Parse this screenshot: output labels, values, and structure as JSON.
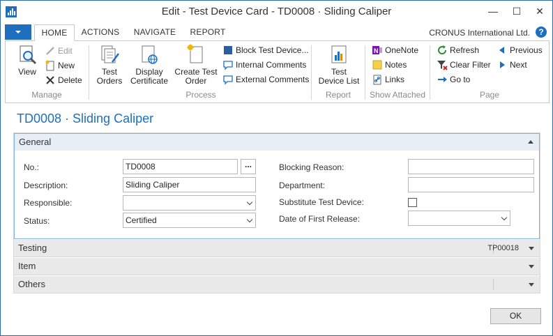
{
  "window": {
    "title": "Edit - Test Device Card - TD0008 · Sliding Caliper",
    "controls": {
      "minimize": "—",
      "maximize": "☐",
      "close": "✕"
    }
  },
  "ribbon": {
    "tabs": [
      {
        "label": "HOME",
        "active": true
      },
      {
        "label": "ACTIONS",
        "active": false
      },
      {
        "label": "NAVIGATE",
        "active": false
      },
      {
        "label": "REPORT",
        "active": false
      }
    ],
    "company": "CRONUS International Ltd.",
    "help": "?",
    "groups": {
      "manage": {
        "label": "Manage",
        "view": "View",
        "edit": "Edit",
        "new": "New",
        "delete": "Delete"
      },
      "process": {
        "label": "Process",
        "test_orders": [
          "Test",
          "Orders"
        ],
        "display_certificate": [
          "Display",
          "Certificate"
        ],
        "create_test_order": [
          "Create Test",
          "Order"
        ],
        "block_test_device": "Block Test Device...",
        "internal_comments": "Internal Comments",
        "external_comments": "External Comments"
      },
      "report": {
        "label": "Report",
        "test_device_list": [
          "Test",
          "Device List"
        ]
      },
      "show_attached": {
        "label": "Show Attached",
        "onenote": "OneNote",
        "notes": "Notes",
        "links": "Links"
      },
      "page": {
        "label": "Page",
        "refresh": "Refresh",
        "clear_filter": "Clear Filter",
        "go_to": "Go to",
        "previous": "Previous",
        "next": "Next"
      }
    }
  },
  "page_title": "TD0008 · Sliding Caliper",
  "general": {
    "header": "General",
    "fields": {
      "no": {
        "label": "No.:",
        "value": "TD0008",
        "assist": "..."
      },
      "description": {
        "label": "Description:",
        "value": "Sliding Caliper"
      },
      "responsible": {
        "label": "Responsible:",
        "value": ""
      },
      "status": {
        "label": "Status:",
        "value": "Certified"
      },
      "blocking_reason": {
        "label": "Blocking Reason:",
        "value": ""
      },
      "department": {
        "label": "Department:",
        "value": ""
      },
      "substitute_test_device": {
        "label": "Substitute Test Device:",
        "checked": false
      },
      "date_of_first_release": {
        "label": "Date of First Release:",
        "value": ""
      }
    }
  },
  "fasttabs": [
    {
      "label": "Testing",
      "summary": "TP00018"
    },
    {
      "label": "Item",
      "summary": ""
    },
    {
      "label": "Others",
      "summary": ""
    }
  ],
  "ok_button": "OK"
}
